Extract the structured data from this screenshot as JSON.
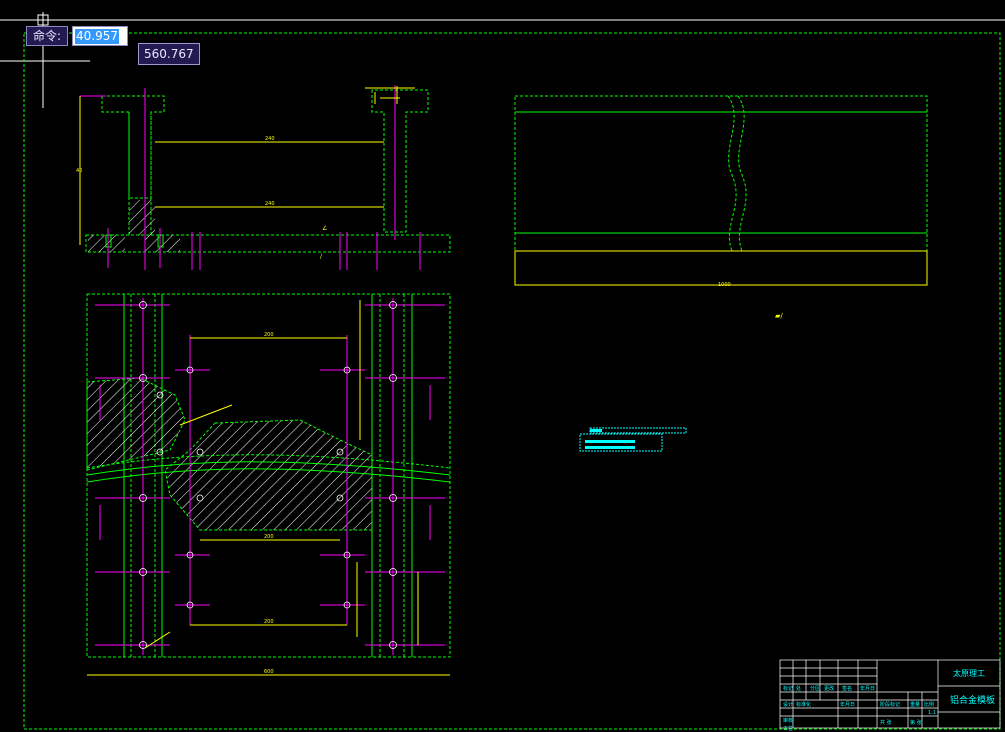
{
  "command": {
    "label": "命令:",
    "value": "40.957"
  },
  "coordinate_tooltip": "560.767",
  "title_block": {
    "school": "太原理工",
    "drawing_name": "铝合金模板"
  },
  "colors": {
    "background": "#000000",
    "border": "#00ff00",
    "outline": "#00ff00",
    "centerline": "#ff00ff",
    "dimension": "#ffff00",
    "text": "#00ffff",
    "crosshair": "#ffffff"
  }
}
